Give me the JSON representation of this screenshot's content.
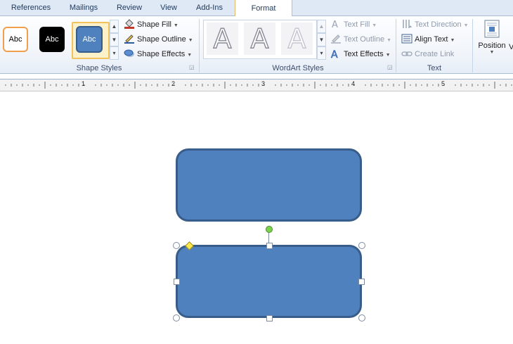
{
  "tabs": [
    {
      "label": "References"
    },
    {
      "label": "Mailings"
    },
    {
      "label": "Review"
    },
    {
      "label": "View"
    },
    {
      "label": "Add-Ins"
    },
    {
      "label": "Format",
      "active": true
    }
  ],
  "shape_styles": {
    "label": "Shape Styles",
    "swatches": [
      {
        "text": "Abc",
        "fill": "#ffffff",
        "border": "#f0a04b",
        "color": "#000000"
      },
      {
        "text": "Abc",
        "fill": "#000000",
        "border": "#000000",
        "color": "#ffffff"
      },
      {
        "text": "Abc",
        "fill": "#4e81bd",
        "border": "#385d8a",
        "color": "#ffffff",
        "selected": true
      }
    ],
    "commands": [
      {
        "label": "Shape Fill",
        "icon": "paint-bucket-icon"
      },
      {
        "label": "Shape Outline",
        "icon": "pen-outline-icon"
      },
      {
        "label": "Shape Effects",
        "icon": "shape-effects-icon"
      }
    ]
  },
  "wordart_styles": {
    "label": "WordArt Styles",
    "letters": [
      {
        "text": "A",
        "dim": false
      },
      {
        "text": "A",
        "dim": false
      },
      {
        "text": "A",
        "dim": true
      }
    ],
    "commands": [
      {
        "label": "Text Fill",
        "icon": "text-fill-icon",
        "enabled": false
      },
      {
        "label": "Text Outline",
        "icon": "text-outline-icon",
        "enabled": false
      },
      {
        "label": "Text Effects",
        "icon": "text-effects-icon",
        "enabled": true
      }
    ]
  },
  "text_group": {
    "label": "Text",
    "commands": [
      {
        "label": "Text Direction",
        "icon": "text-direction-icon",
        "enabled": false
      },
      {
        "label": "Align Text",
        "icon": "align-text-icon",
        "enabled": true
      },
      {
        "label": "Create Link",
        "icon": "link-icon",
        "enabled": false
      }
    ]
  },
  "arrange": {
    "position_label": "Position",
    "partial_label": "V"
  },
  "ruler": {
    "numbers": [
      "1",
      "2",
      "3",
      "4",
      "5"
    ]
  },
  "colors": {
    "shape_fill": "#4e81bd",
    "shape_border": "#385d8a",
    "tab_accent": "#e4b86a"
  }
}
